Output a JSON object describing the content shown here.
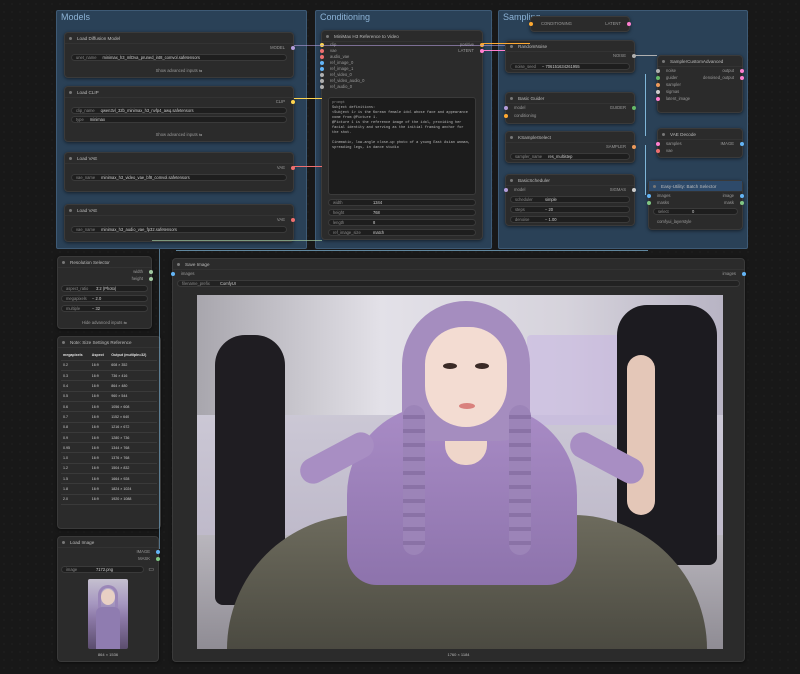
{
  "groups": {
    "models": "Models",
    "conditioning": "Conditioning",
    "sampling": "Sampling"
  },
  "load_diffusion": {
    "title": "Load Diffusion Model",
    "out_model": "MODEL",
    "unet_name_label": "unet_name",
    "unet_name": "minimax_h3_mlDva_pruned_int8_comvol.safetensors",
    "show_advanced": "Show advanced inputs"
  },
  "load_clip": {
    "title": "Load CLIP",
    "out_clip": "CLIP",
    "clip_name_label": "clip_name",
    "clip_name": "qwen3vl_32b_minimax_h3_nvfp4_awq.safetensors",
    "type_label": "type",
    "type": "minimax",
    "show_advanced": "Show advanced inputs"
  },
  "load_vae": {
    "title": "Load VAE",
    "out_vae": "VAE",
    "vae_name_label": "vae_name",
    "vae_name": "minimax_h3_video_vae_bf8_comvol.safetensors"
  },
  "load_vae2": {
    "title": "Load VAE",
    "out_vae": "VAE",
    "vae_name_label": "vae_name",
    "vae_name": "minimax_h3_audio_vae_fp32.safetensors"
  },
  "ref2video": {
    "title": "MiniMax H3 Reference to Video",
    "inputs": [
      "clip",
      "vae",
      "audio_vae",
      "ref_image_0",
      "ref_image_1",
      "ref_video_0",
      "ref_video_audio_0",
      "ref_audio_0"
    ],
    "out_positive": "positive",
    "out_latent": "LATENT",
    "prompt_label": "prompt",
    "prompt": "Subject definitions:\n<Subject 1> is the Korean female idol whose face and appearance come from @Picture 1.\n@Picture 1 is the reference image of the idol, providing her facial identity and serving as the initial framing anchor for the shot.\n\nCinematic, low-angle close-up photo of a young East Asian woman, spreading legs, in dance studio",
    "width_label": "width",
    "width": "1344",
    "height_label": "height",
    "height": "768",
    "length_label": "length",
    "length": "8",
    "ref_image_size_label": "ref_image_size",
    "ref_image_size": "match"
  },
  "sampling_top": {
    "conditioning": "CONDITIONING",
    "latent": "LATENT"
  },
  "random_noise": {
    "title": "RandomNoise",
    "out": "NOISE",
    "noise_seed_label": "noise_seed",
    "noise_seed": "706151634261955"
  },
  "basic_guider": {
    "title": "Basic Guider",
    "in_model": "model",
    "in_cond": "conditioning",
    "out": "GUIDER"
  },
  "ksampler_select": {
    "title": "KSamplerSelect",
    "out": "SAMPLER",
    "sampler_name_label": "sampler_name",
    "sampler_name": "res_multistep"
  },
  "basic_scheduler": {
    "title": "BasicScheduler",
    "in_model": "model",
    "out": "SIGMAS",
    "scheduler_label": "scheduler",
    "scheduler": "simple",
    "steps_label": "steps",
    "steps": "20",
    "denoise_label": "denoise",
    "denoise": "1.00"
  },
  "sampler_custom": {
    "title": "SamplerCustomAdvanced",
    "inputs": [
      "noise",
      "guider",
      "sampler",
      "sigmas",
      "latent_image"
    ],
    "out1": "output",
    "out2": "denoised_output"
  },
  "vae_decode": {
    "title": "VAE Decode",
    "in_samples": "samples",
    "in_vae": "vae",
    "out": "IMAGE"
  },
  "batch_selector": {
    "title": "Easy-Utility: Batch Selector",
    "in_images": "images",
    "in_masks": "masks",
    "out_image": "image",
    "out_mask": "mask",
    "select_label": "select",
    "select": "0",
    "footer": "comfyui_layerstyle"
  },
  "resolution_selector": {
    "title": "Resolution Selector",
    "out_width": "width",
    "out_height": "height",
    "aspect_ratio_label": "aspect_ratio",
    "aspect_ratio": "3:2 (Photo)",
    "megapixels_label": "megapixels",
    "megapixels": "2.0",
    "multiple_label": "multiple",
    "multiple": "32",
    "hide_advanced": "Hide advanced inputs"
  },
  "size_table": {
    "title": "Note: Size Settings Reference",
    "headers": [
      "megapixels",
      "Aspect",
      "Output (multiple=32)"
    ],
    "rows": [
      [
        "0.2",
        "16:9",
        "608 × 352"
      ],
      [
        "0.3",
        "16:9",
        "736 × 416"
      ],
      [
        "0.4",
        "16:9",
        "864 × 480"
      ],
      [
        "0.5",
        "16:9",
        "960 × 544"
      ],
      [
        "0.6",
        "16:9",
        "1056 × 608"
      ],
      [
        "0.7",
        "16:9",
        "1152 × 640"
      ],
      [
        "0.8",
        "16:9",
        "1216 × 672"
      ],
      [
        "0.9",
        "16:9",
        "1280 × 736"
      ],
      [
        "0.95",
        "16:9",
        "1344 × 768"
      ],
      [
        "1.0",
        "16:9",
        "1376 × 768"
      ],
      [
        "1.2",
        "16:9",
        "1504 × 832"
      ],
      [
        "1.5",
        "16:9",
        "1664 × 928"
      ],
      [
        "1.8",
        "16:9",
        "1824 × 1024"
      ],
      [
        "2.0",
        "16:9",
        "1920 × 1088"
      ]
    ]
  },
  "load_image": {
    "title": "Load Image",
    "out_image": "IMAGE",
    "out_mask": "MASK",
    "image_label": "image",
    "image": "7172.png",
    "dims": "864 × 1536"
  },
  "save_image": {
    "title": "Save Image",
    "in_images": "images",
    "out_images": "images",
    "filename_prefix_label": "filename_prefix",
    "filename_prefix": "ComfyUI",
    "dims": "1760 × 1184"
  },
  "colors": {
    "group_bg": "#2a4157",
    "node_bg": "#2b2b2b",
    "wire": "#7fb6d8",
    "canvas": "#181818"
  }
}
